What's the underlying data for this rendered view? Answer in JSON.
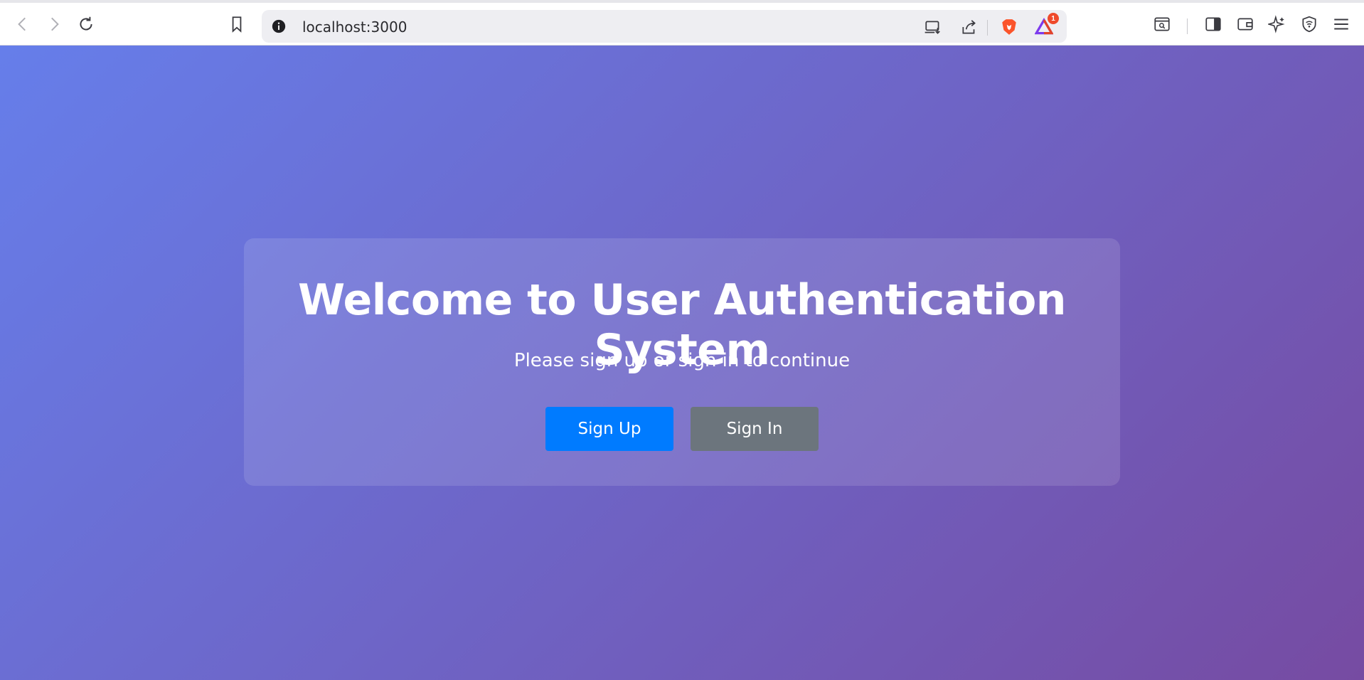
{
  "browser": {
    "url": "localhost:3000",
    "notification_count": "1"
  },
  "page": {
    "title": "Welcome to User Authentication System",
    "subtitle": "Please sign up or sign in to continue",
    "signup_label": "Sign Up",
    "signin_label": "Sign In"
  },
  "colors": {
    "gradient_start": "#667eea",
    "gradient_end": "#764ba2",
    "signup_bg": "#007bff",
    "signin_bg": "#6c757d"
  },
  "icons": [
    "back-icon",
    "forward-icon",
    "reload-icon",
    "bookmark-icon",
    "site-info-icon",
    "install-app-icon",
    "share-icon",
    "brave-shields-icon",
    "brave-rewards-icon",
    "tab-search-icon",
    "sidebar-icon",
    "wallet-icon",
    "leo-ai-icon",
    "vpn-icon",
    "menu-icon"
  ]
}
